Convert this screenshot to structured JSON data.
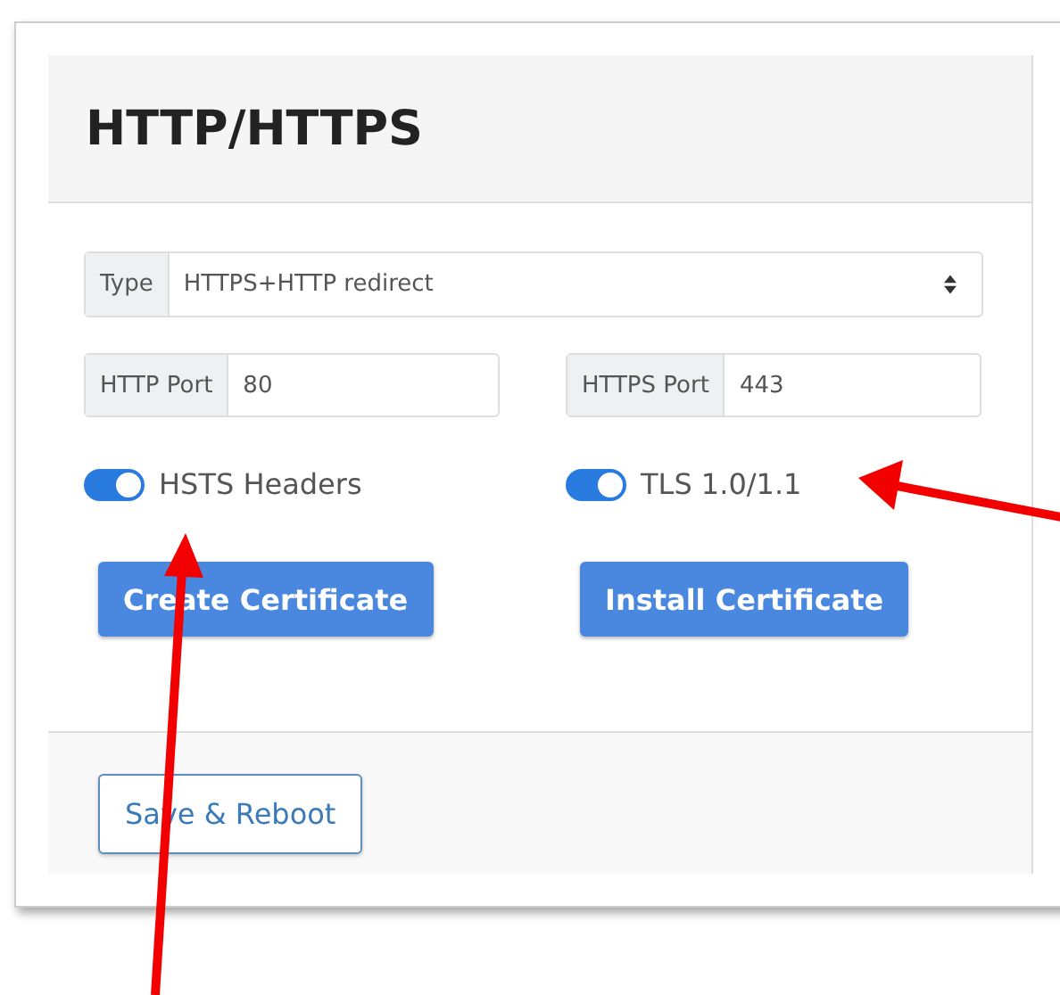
{
  "panel": {
    "title": "HTTP/HTTPS"
  },
  "type_select": {
    "label": "Type",
    "value": "HTTPS+HTTP redirect"
  },
  "ports": [
    {
      "label": "HTTP Port",
      "value": "80"
    },
    {
      "label": "HTTPS Port",
      "value": "443"
    }
  ],
  "toggles": [
    {
      "label": "HSTS Headers",
      "on": true
    },
    {
      "label": "TLS 1.0/1.1",
      "on": true
    }
  ],
  "buttons": [
    "Create Certificate",
    "Install Certificate"
  ],
  "footer": {
    "button": "Save & Reboot"
  }
}
